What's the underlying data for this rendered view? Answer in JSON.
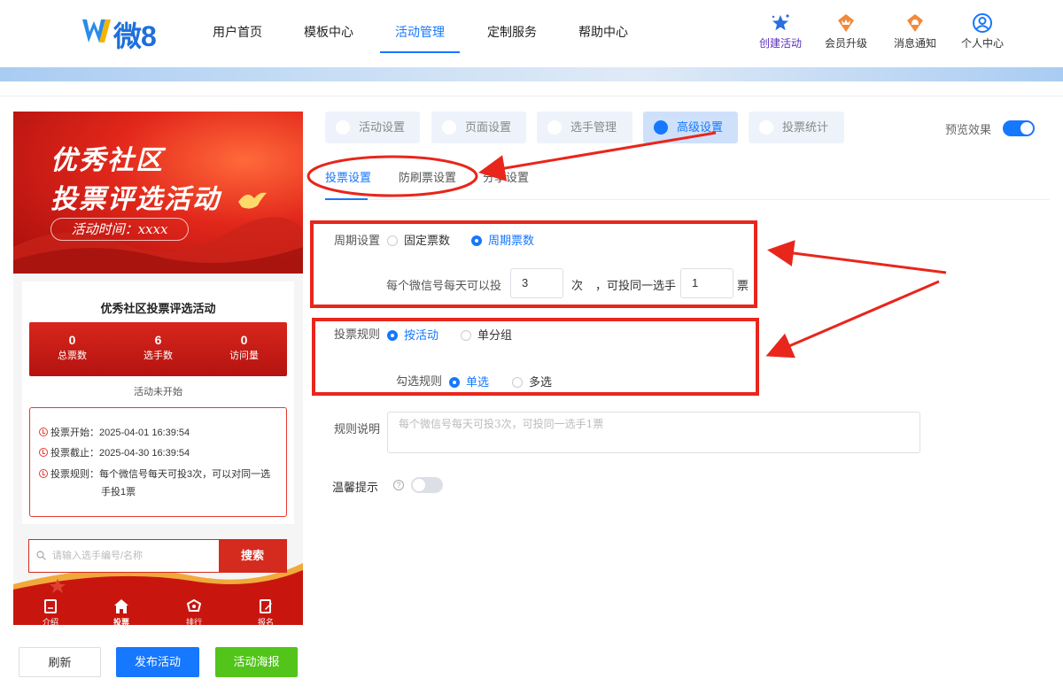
{
  "logo": {
    "text": "微8"
  },
  "nav": [
    {
      "label": "用户首页",
      "active": false
    },
    {
      "label": "模板中心",
      "active": false
    },
    {
      "label": "活动管理",
      "active": true
    },
    {
      "label": "定制服务",
      "active": false
    },
    {
      "label": "帮助中心",
      "active": false
    }
  ],
  "header_actions": [
    {
      "label": "创建活动",
      "icon": "star-icon"
    },
    {
      "label": "会员升级",
      "icon": "crown-icon"
    },
    {
      "label": "消息通知",
      "icon": "bell-icon"
    },
    {
      "label": "个人中心",
      "icon": "user-icon"
    }
  ],
  "preview": {
    "poster": {
      "title_line1": "优秀社区",
      "title_line2": "投票评选活动",
      "time_label": "活动时间：xxxx"
    },
    "activity_title": "优秀社区投票评选活动",
    "stats": [
      {
        "value": "0",
        "label": "总票数"
      },
      {
        "value": "6",
        "label": "选手数"
      },
      {
        "value": "0",
        "label": "访问量"
      }
    ],
    "status": "活动未开始",
    "rules": [
      {
        "label": "投票开始：",
        "value": "2025-04-01 16:39:54"
      },
      {
        "label": "投票截止：",
        "value": "2025-04-30 16:39:54"
      },
      {
        "label": "投票规则：",
        "value": "每个微信号每天可投3次，可以对同一选",
        "value2": "手投1票"
      }
    ],
    "search": {
      "placeholder": "请输入选手编号/名称",
      "button": "搜索"
    },
    "tabbar": [
      "介绍",
      "投票",
      "排行",
      "报名"
    ]
  },
  "bottom_buttons": {
    "refresh": "刷新",
    "publish": "发布活动",
    "poster": "活动海报"
  },
  "settings": {
    "top_tabs": [
      {
        "label": "活动设置",
        "active": false
      },
      {
        "label": "页面设置",
        "active": false
      },
      {
        "label": "选手管理",
        "active": false
      },
      {
        "label": "高级设置",
        "active": true
      },
      {
        "label": "投票统计",
        "active": false
      }
    ],
    "preview_label": "预览效果",
    "preview_enabled": true,
    "sub_tabs": [
      {
        "label": "投票设置",
        "active": true
      },
      {
        "label": "防刷票设置",
        "active": false
      },
      {
        "label": "分享设置",
        "active": false
      }
    ],
    "cycle": {
      "label": "周期设置",
      "options": [
        "固定票数",
        "周期票数"
      ],
      "selected": "周期票数",
      "per_day_prefix": "每个微信号每天可以投",
      "per_day_value": "3",
      "times_unit": "次",
      "same_player_prefix": "，可投同一选手",
      "same_player_value": "1",
      "votes_unit": "票"
    },
    "vote_rule": {
      "label": "投票规则",
      "options": [
        "按活动",
        "单分组"
      ],
      "selected": "按活动",
      "check_label": "勾选规则",
      "check_options": [
        "单选",
        "多选"
      ],
      "check_selected": "单选"
    },
    "rule_desc": {
      "label": "规则说明",
      "placeholder": "每个微信号每天可投3次，可投同一选手1票"
    },
    "tip": {
      "label": "温馨提示",
      "help": "?",
      "enabled": false
    }
  },
  "colors": {
    "accent": "#1677ff",
    "brand_red": "#d52a1e",
    "annotation": "#e8261b",
    "green": "#52c41a"
  }
}
